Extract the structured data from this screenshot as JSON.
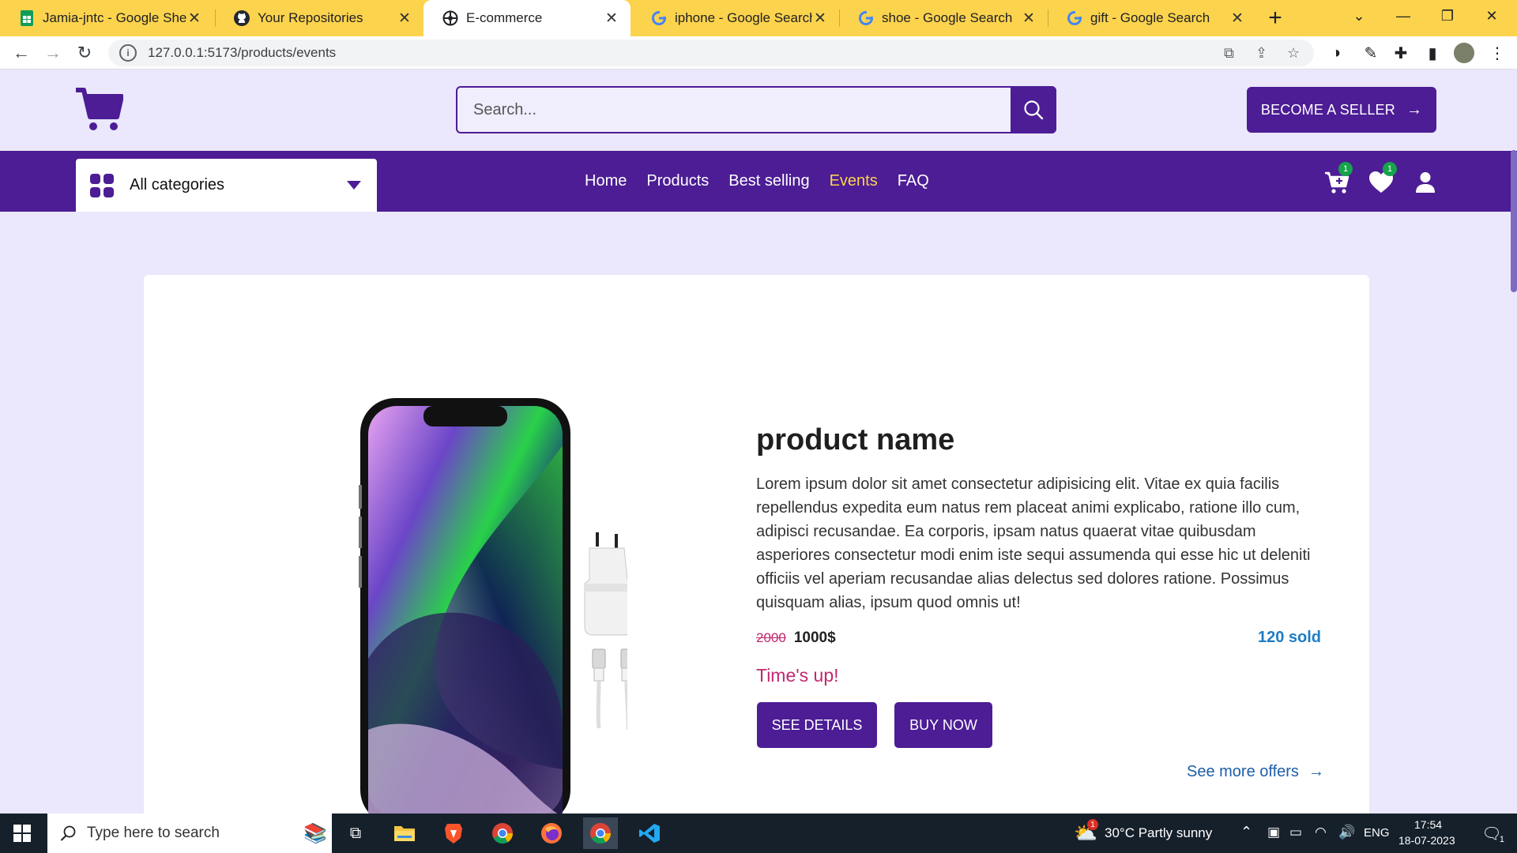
{
  "browser": {
    "tabs": [
      {
        "title": "Jamia-jntc - Google Sheets",
        "icon": "sheets-icon",
        "active": false
      },
      {
        "title": "Your Repositories",
        "icon": "github-icon",
        "active": false
      },
      {
        "title": "E-commerce",
        "icon": "site-icon",
        "active": true
      },
      {
        "title": "iphone - Google Search",
        "icon": "google-icon",
        "active": false
      },
      {
        "title": "shoe - Google Search",
        "icon": "google-icon",
        "active": false
      },
      {
        "title": "gift - Google Search",
        "icon": "google-icon",
        "active": false
      }
    ],
    "close_glyph": "✕",
    "url": "127.0.0.1:5173/products/events"
  },
  "header": {
    "search_placeholder": "Search...",
    "seller_button": "BECOME A SELLER",
    "brand_color": "#4c1d95"
  },
  "nav": {
    "categories_label": "All categories",
    "links": [
      {
        "label": "Home",
        "active": false
      },
      {
        "label": "Products",
        "active": false
      },
      {
        "label": "Best selling",
        "active": false
      },
      {
        "label": "Events",
        "active": true
      },
      {
        "label": "FAQ",
        "active": false
      }
    ],
    "cart_count": "1",
    "wishlist_count": "1"
  },
  "event": {
    "product_name": "product name",
    "description": "Lorem ipsum dolor sit amet consectetur adipisicing elit. Vitae ex quia facilis repellendus expedita eum natus rem placeat animi explicabo, ratione illo cum, adipisci recusandae. Ea corporis, ipsam natus quaerat vitae quibusdam asperiores consectetur modi enim iste sequi assumenda qui esse hic ut deleniti officiis vel aperiam recusandae alias delectus sed dolores ratione. Possimus quisquam alias, ipsum quod omnis ut!",
    "original_price": "2000",
    "discount_price": "1000$",
    "sold": "120 sold",
    "timer_text": "Time's up!",
    "see_details": "SEE DETAILS",
    "buy_now": "BUY NOW",
    "more_offers": "See more offers"
  },
  "taskbar": {
    "search_placeholder": "Type here to search",
    "weather": "30°C  Partly sunny",
    "weather_badge": "1",
    "language": "ENG",
    "time": "17:54",
    "date": "18-07-2023",
    "notification_count": "1"
  }
}
